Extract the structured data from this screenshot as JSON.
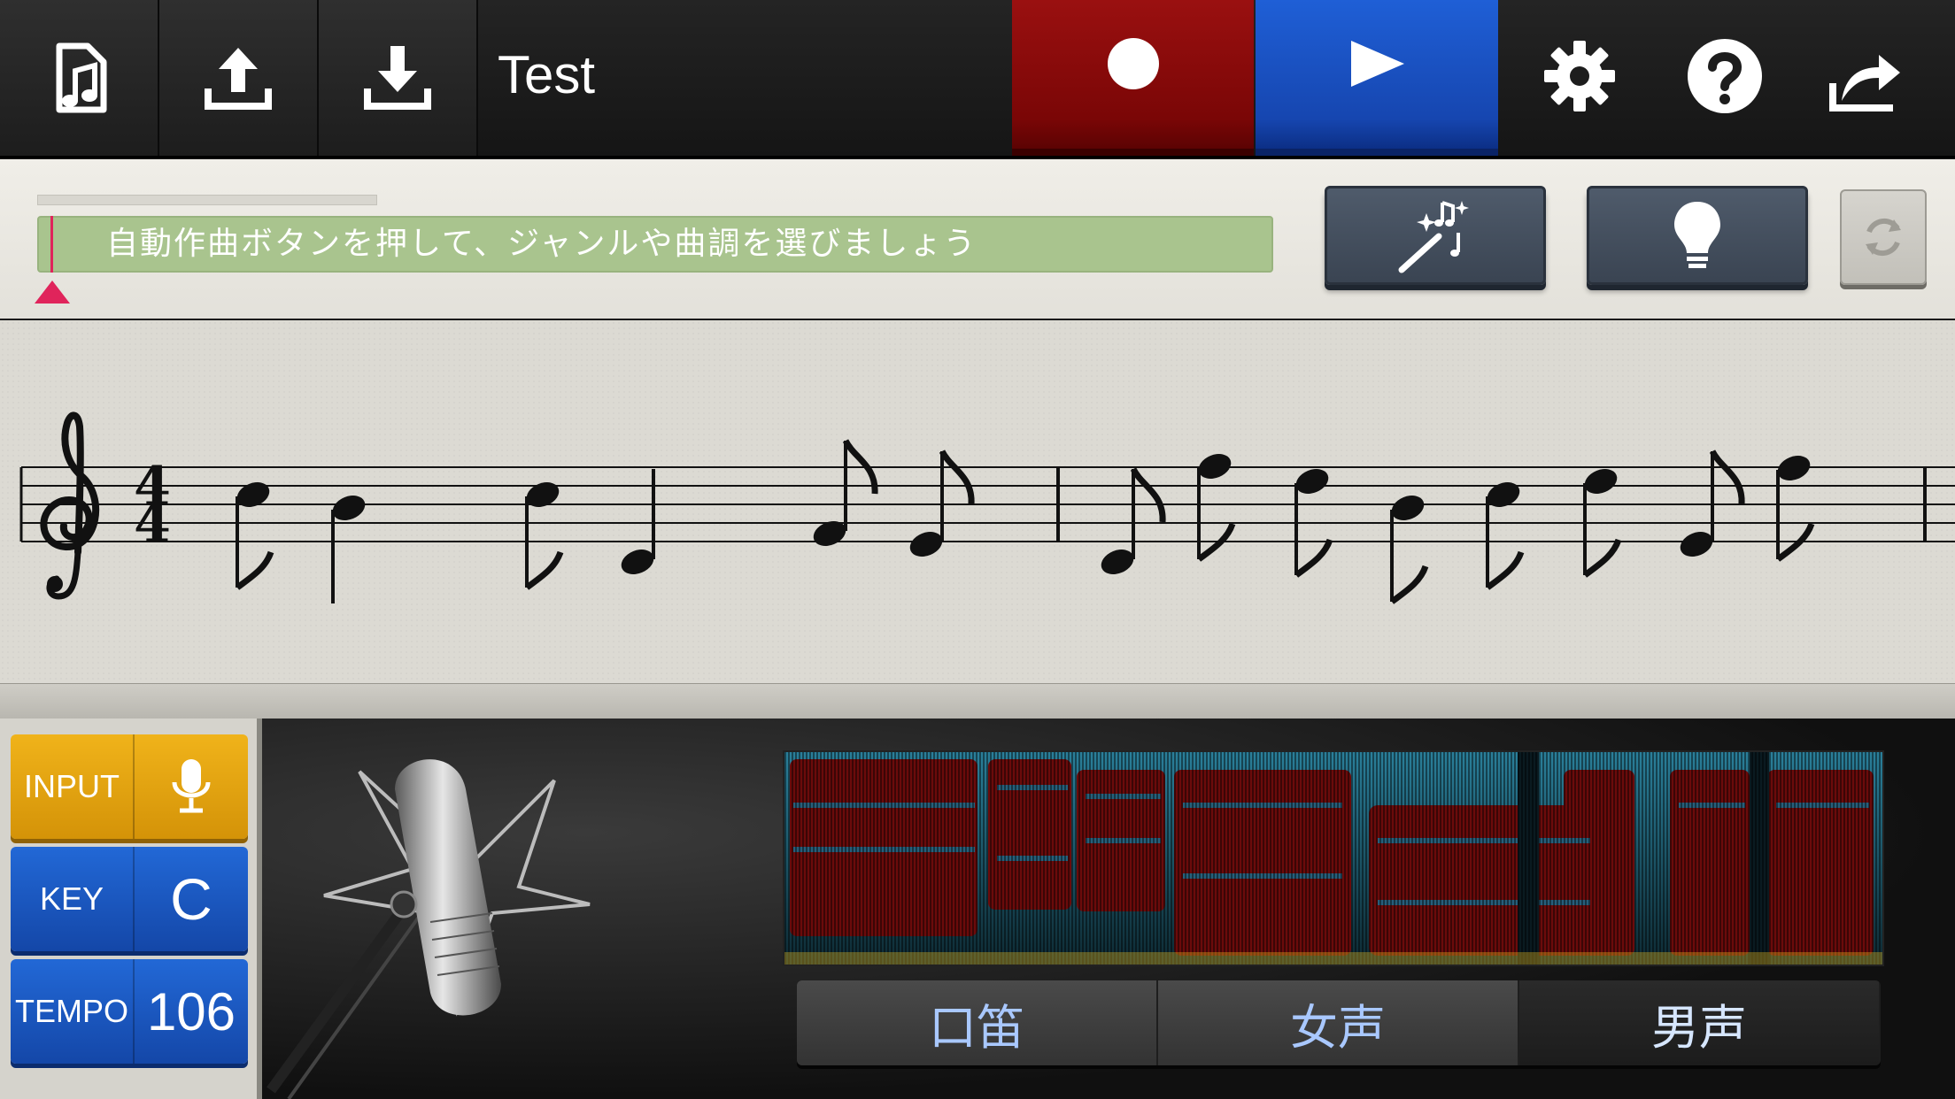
{
  "toolbar": {
    "song_title": "Test",
    "buttons": {
      "song_list": "music-file-icon",
      "upload": "upload-icon",
      "download": "download-icon",
      "record": "record-icon",
      "play": "play-icon",
      "settings": "gear-icon",
      "help": "help-icon",
      "share": "share-icon"
    },
    "colors": {
      "record": "#8b0a0a",
      "play": "#1a52c4"
    }
  },
  "top_panel": {
    "message": "自動作曲ボタンを押して、ジャンルや曲調を選びましょう",
    "message_bg": "#a9c48e",
    "playhead_color": "#e0245b",
    "buttons": {
      "auto_compose": "magic-wand-music-icon",
      "hint": "lightbulb-icon",
      "refresh": "refresh-icon"
    }
  },
  "score": {
    "clef": "treble",
    "time_signature": {
      "top": "4",
      "bottom": "4"
    }
  },
  "controls": {
    "input": {
      "label": "INPUT",
      "icon": "microphone-icon",
      "color": "#e5a412"
    },
    "key": {
      "label": "KEY",
      "value": "C",
      "color": "#1a55c0"
    },
    "tempo": {
      "label": "TEMPO",
      "value": "106",
      "color": "#1a55c0"
    }
  },
  "voice_tabs": [
    {
      "label": "口笛",
      "selected": false
    },
    {
      "label": "女声",
      "selected": false
    },
    {
      "label": "男声",
      "selected": true
    }
  ]
}
